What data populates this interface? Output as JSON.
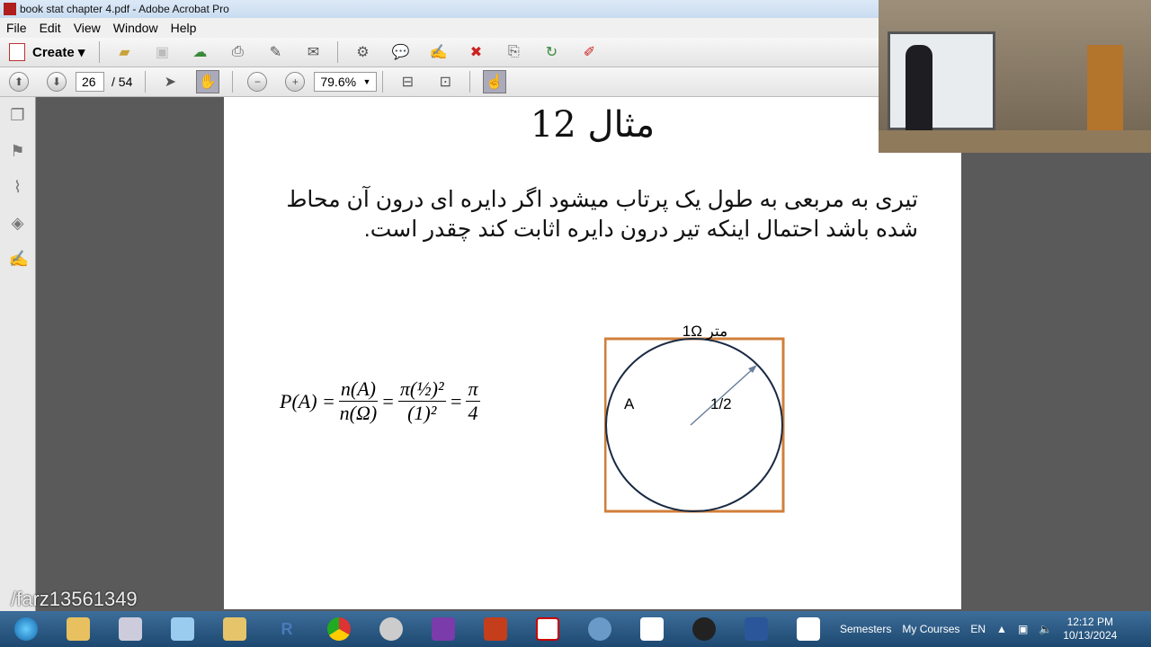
{
  "window": {
    "title": "book stat chapter 4.pdf - Adobe Acrobat Pro"
  },
  "menu": [
    "File",
    "Edit",
    "View",
    "Window",
    "Help"
  ],
  "toolbar": {
    "create_label": "Create"
  },
  "nav": {
    "page_current": "26",
    "page_total": "/ 54",
    "zoom": "79.6%"
  },
  "document": {
    "title": "مثال 12",
    "problem": "تیری به مربعی به طول یک پرتاب میشود اگر دایره ای درون آن محاط شده باشد احتمال اینکه تیر درون دایره اثابت کند چقدر است.",
    "formula": {
      "lhs": "P(A) =",
      "f1n": "n(A)",
      "f1d": "n(Ω)",
      "f2n": "π(½)²",
      "f2d": "(1)²",
      "f3n": "π",
      "f3d": "4",
      "eq": "="
    },
    "diagram": {
      "top_label": "1Ω متر",
      "region_label": "A",
      "radius_label": "1/2",
      "square_color": "#d07f3a",
      "circle_color": "#1a2a44"
    }
  },
  "watermark": "/farz13561349",
  "taskbar": {
    "semesters": "Semesters",
    "my_courses": "My Courses",
    "lang": "EN",
    "time": "12:12 PM",
    "date": "10/13/2024"
  }
}
